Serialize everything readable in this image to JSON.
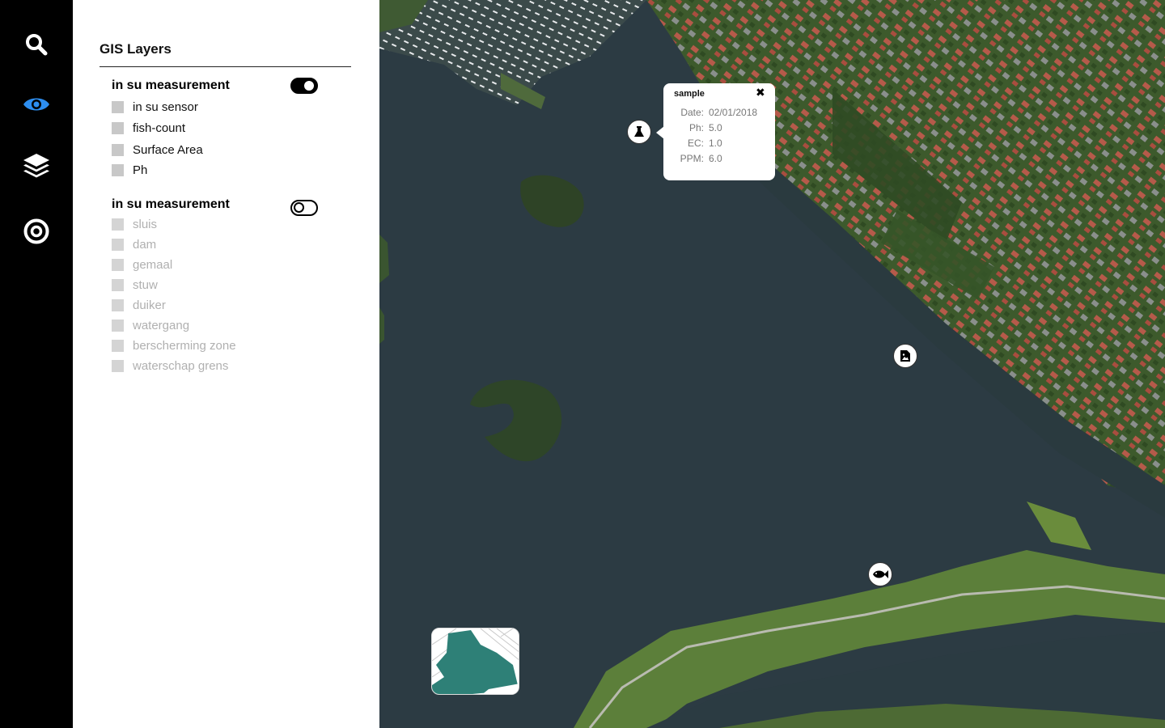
{
  "sidebar": {
    "items": [
      {
        "icon": "search-icon",
        "active": false
      },
      {
        "icon": "eye-icon",
        "active": true
      },
      {
        "icon": "layers-icon",
        "active": false
      },
      {
        "icon": "target-icon",
        "active": false
      }
    ],
    "active_color": "#2d8ef0",
    "icon_color": "#ffffff"
  },
  "panel": {
    "title": "GIS Layers",
    "groups": [
      {
        "title": "in su measurement",
        "enabled": true,
        "layers": [
          "in su sensor",
          "fish-count",
          "Surface Area",
          "Ph"
        ]
      },
      {
        "title": "in su measurement",
        "enabled": false,
        "layers": [
          "sluis",
          "dam",
          "gemaal",
          "stuw",
          "duiker",
          "watergang",
          "berscherming zone",
          "waterschap grens"
        ]
      }
    ]
  },
  "map": {
    "markers": [
      {
        "type": "sample",
        "icon": "flask-icon"
      },
      {
        "type": "report",
        "icon": "document-image-icon"
      },
      {
        "type": "fish",
        "icon": "fish-icon"
      }
    ],
    "popup": {
      "title": "sample",
      "close": "✖",
      "fields": [
        {
          "key": "Date:",
          "value": "02/01/2018"
        },
        {
          "key": "Ph:",
          "value": "5.0"
        },
        {
          "key": "EC:",
          "value": "1.0"
        },
        {
          "key": "PPM:",
          "value": "6.0"
        }
      ]
    },
    "minimap": {
      "water_color": "#2e8077"
    }
  }
}
